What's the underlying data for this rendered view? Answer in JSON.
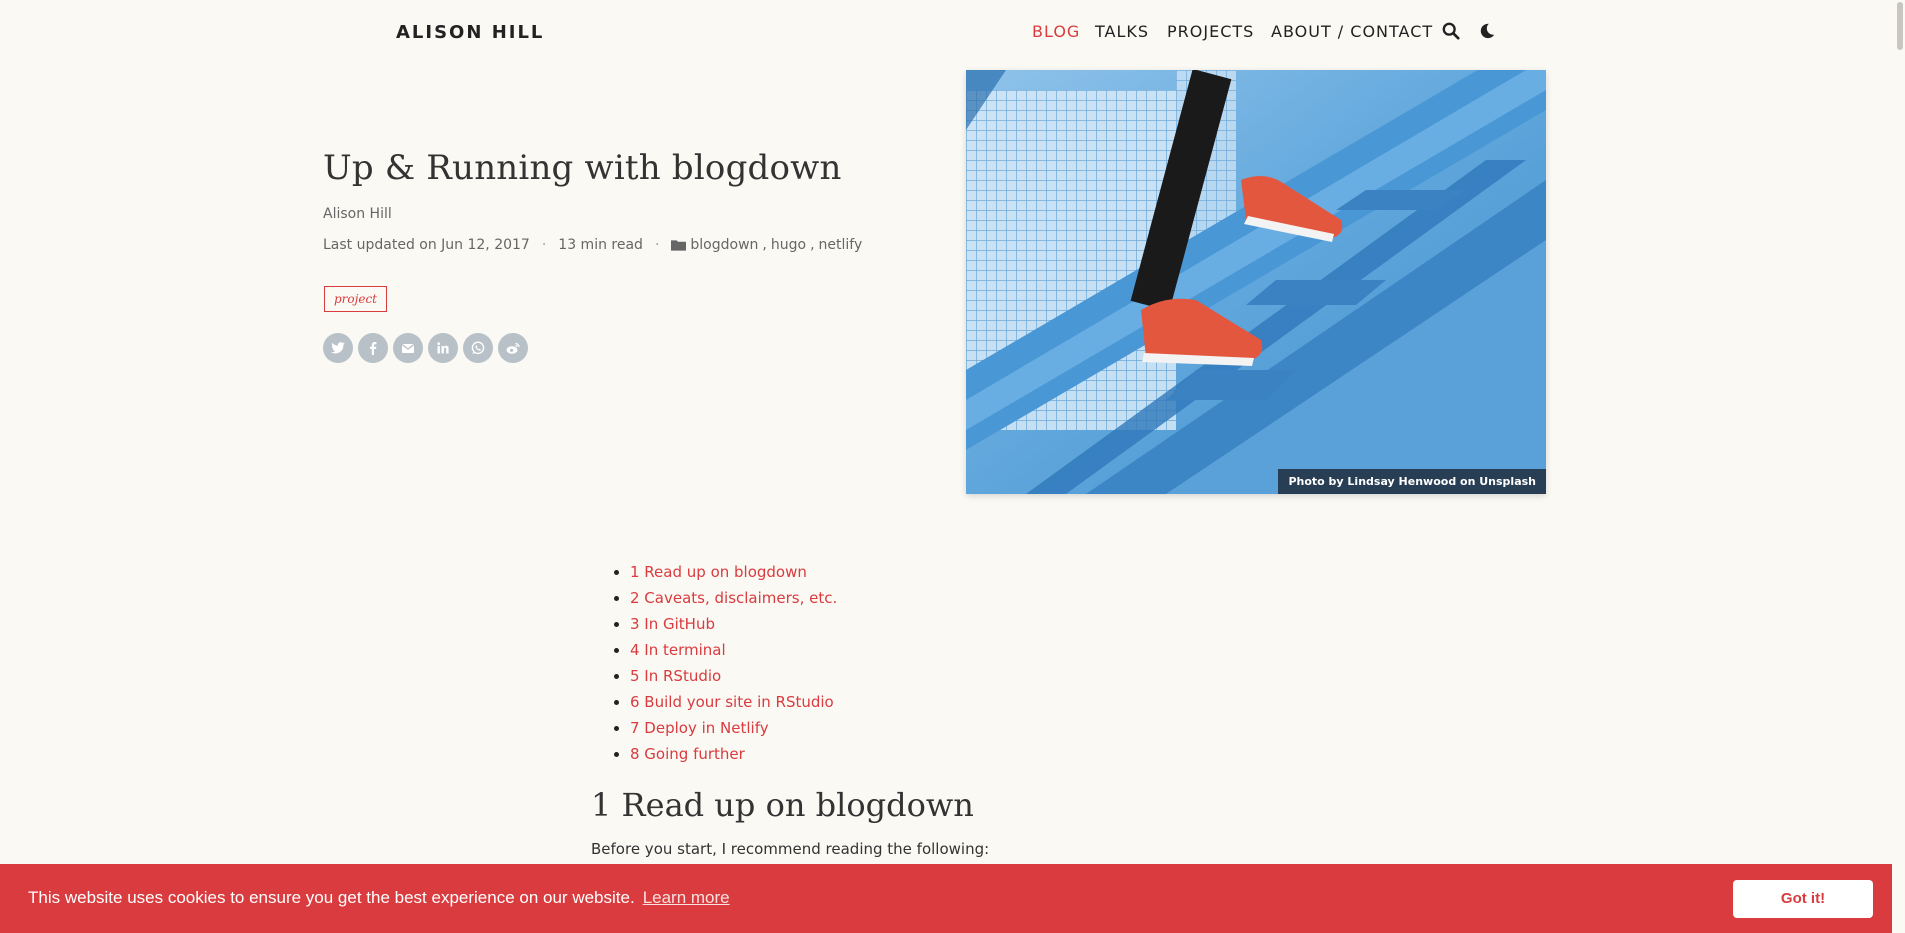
{
  "brand": "ALISON HILL",
  "nav": {
    "items": [
      {
        "label": "BLOG",
        "active": true
      },
      {
        "label": "TALKS"
      },
      {
        "label": "PROJECTS"
      },
      {
        "label": "ABOUT / CONTACT"
      }
    ],
    "icons": [
      "search-icon",
      "moon-icon"
    ]
  },
  "post": {
    "title": "Up & Running with blogdown",
    "author": "Alison Hill",
    "updated": "Last updated on Jun 12, 2017",
    "read_time": "13 min read",
    "sep": "·",
    "categories": [
      "blogdown",
      "hugo",
      "netlify"
    ],
    "category_sep": ",",
    "tag": "project",
    "share_icons": [
      "twitter-icon",
      "facebook-icon",
      "email-icon",
      "linkedin-icon",
      "whatsapp-icon",
      "weibo-icon"
    ]
  },
  "image": {
    "caption": "Photo by Lindsay Henwood on Unsplash"
  },
  "toc": [
    "1 Read up on blogdown",
    "2 Caveats, disclaimers, etc.",
    "3 In GitHub",
    "4 In terminal",
    "5 In RStudio",
    "6 Build your site in RStudio",
    "7 Deploy in Netlify",
    "8 Going further"
  ],
  "section": {
    "title": "1 Read up on blogdown",
    "text": "Before you start, I recommend reading the following:"
  },
  "cookie": {
    "message": "This website uses cookies to ensure you get the best experience on our website.",
    "learn_more": "Learn more",
    "button": "Got it!"
  },
  "colors": {
    "accent": "#d93b3f",
    "background": "#fbf9f4",
    "share_icon_bg": "#b7c1c7"
  }
}
